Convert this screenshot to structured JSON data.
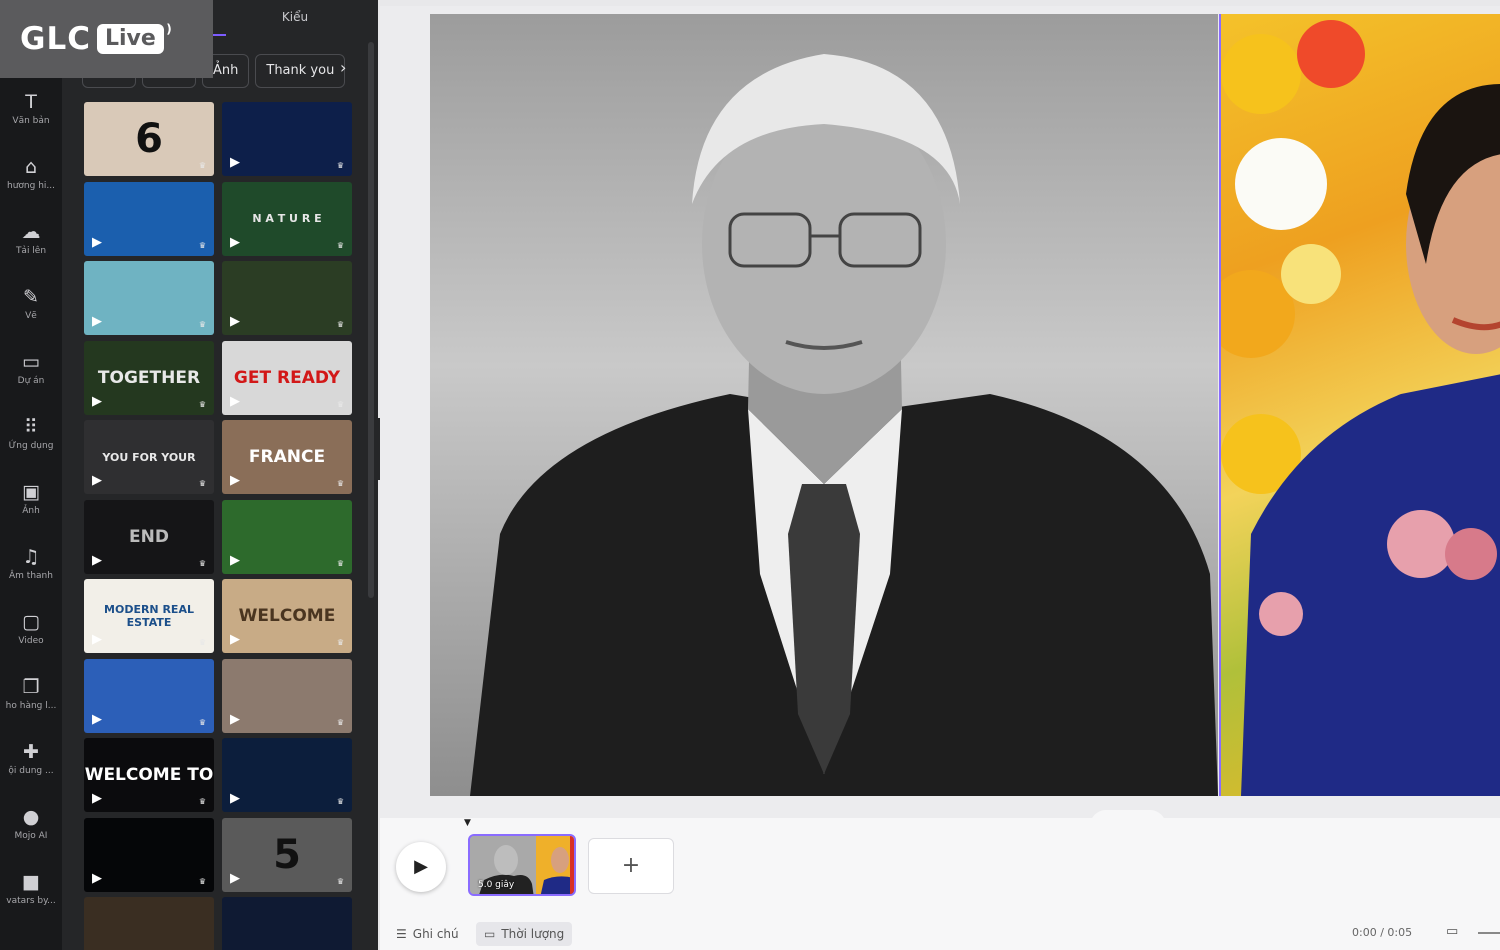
{
  "logo": {
    "brand": "GLC",
    "badge": "Live"
  },
  "rail": {
    "items": [
      {
        "icon": "text-icon",
        "glyph": "T",
        "label": "Văn bản"
      },
      {
        "icon": "brand-icon",
        "glyph": "⌂",
        "label": "hương hi..."
      },
      {
        "icon": "upload-icon",
        "glyph": "☁",
        "label": "Tải lên"
      },
      {
        "icon": "draw-icon",
        "glyph": "✎",
        "label": "Vẽ"
      },
      {
        "icon": "folder-icon",
        "glyph": "▭",
        "label": "Dự án"
      },
      {
        "icon": "apps-icon",
        "glyph": "⠿",
        "label": "Ứng dụng"
      },
      {
        "icon": "image-icon",
        "glyph": "▣",
        "label": "Ảnh"
      },
      {
        "icon": "music-icon",
        "glyph": "♫",
        "label": "Âm thanh"
      },
      {
        "icon": "video-icon",
        "glyph": "▢",
        "label": "Video"
      },
      {
        "icon": "layers-icon",
        "glyph": "❐",
        "label": "ho hàng l..."
      },
      {
        "icon": "magic-icon",
        "glyph": "✚",
        "label": "ội dung ..."
      },
      {
        "icon": "ai-icon",
        "glyph": "●",
        "label": "Mojo AI"
      },
      {
        "icon": "avatar-icon",
        "glyph": "■",
        "label": "vatars by..."
      }
    ]
  },
  "panel": {
    "header": "Kiểu",
    "tags": [
      "",
      "",
      "Ảnh",
      "Thank you"
    ],
    "next_glyph": "›",
    "thumbs": [
      {
        "caption": "6",
        "bg": "#d9c9b8",
        "fg": "#111"
      },
      {
        "caption": "",
        "bg": "#0d1f4a",
        "fg": "#fff"
      },
      {
        "caption": "",
        "bg": "#1b5fae",
        "fg": "#fff"
      },
      {
        "caption": "N A T U R E",
        "bg": "#1f4a2a",
        "fg": "#e6e6e6"
      },
      {
        "caption": "",
        "bg": "#6fb3c2",
        "fg": "#fff"
      },
      {
        "caption": "",
        "bg": "#2b3d24",
        "fg": "#fff"
      },
      {
        "caption": "TOGETHER",
        "bg": "#24381f",
        "fg": "#e8e8e8"
      },
      {
        "caption": "GET READY",
        "bg": "#d8d8d8",
        "fg": "#d21818"
      },
      {
        "caption": "YOU FOR YOUR",
        "bg": "#2f2f31",
        "fg": "#e8e8e8"
      },
      {
        "caption": "FRANCE",
        "bg": "#8a6e58",
        "fg": "#fff"
      },
      {
        "caption": "END",
        "bg": "#151517",
        "fg": "#bbb"
      },
      {
        "caption": "",
        "bg": "#2d6a2c",
        "fg": "#fff"
      },
      {
        "caption": "MODERN REAL ESTATE",
        "bg": "#f2efe8",
        "fg": "#1c4f8a"
      },
      {
        "caption": "WELCOME",
        "bg": "#c8ab86",
        "fg": "#4a3520"
      },
      {
        "caption": "",
        "bg": "#2c5fb8",
        "fg": "#fff"
      },
      {
        "caption": "",
        "bg": "#8c7a6e",
        "fg": "#fff"
      },
      {
        "caption": "WELCOME TO",
        "bg": "#0b0b0d",
        "fg": "#fff"
      },
      {
        "caption": "",
        "bg": "#0c1e3c",
        "fg": "#fff"
      },
      {
        "caption": "",
        "bg": "#050608",
        "fg": "#2ec6e6"
      },
      {
        "caption": "5",
        "bg": "#5a5a5a",
        "fg": "#111"
      },
      {
        "caption": "",
        "bg": "#3a2e22",
        "fg": "#fff"
      },
      {
        "caption": "",
        "bg": "#0f1a33",
        "fg": "#fff"
      }
    ]
  },
  "timeline": {
    "clip_duration": "5.0 giây",
    "add_glyph": "+",
    "notes_label": "Ghi chú",
    "duration_label": "Thời lượng",
    "time_readout": "0:00 / 0:05"
  }
}
